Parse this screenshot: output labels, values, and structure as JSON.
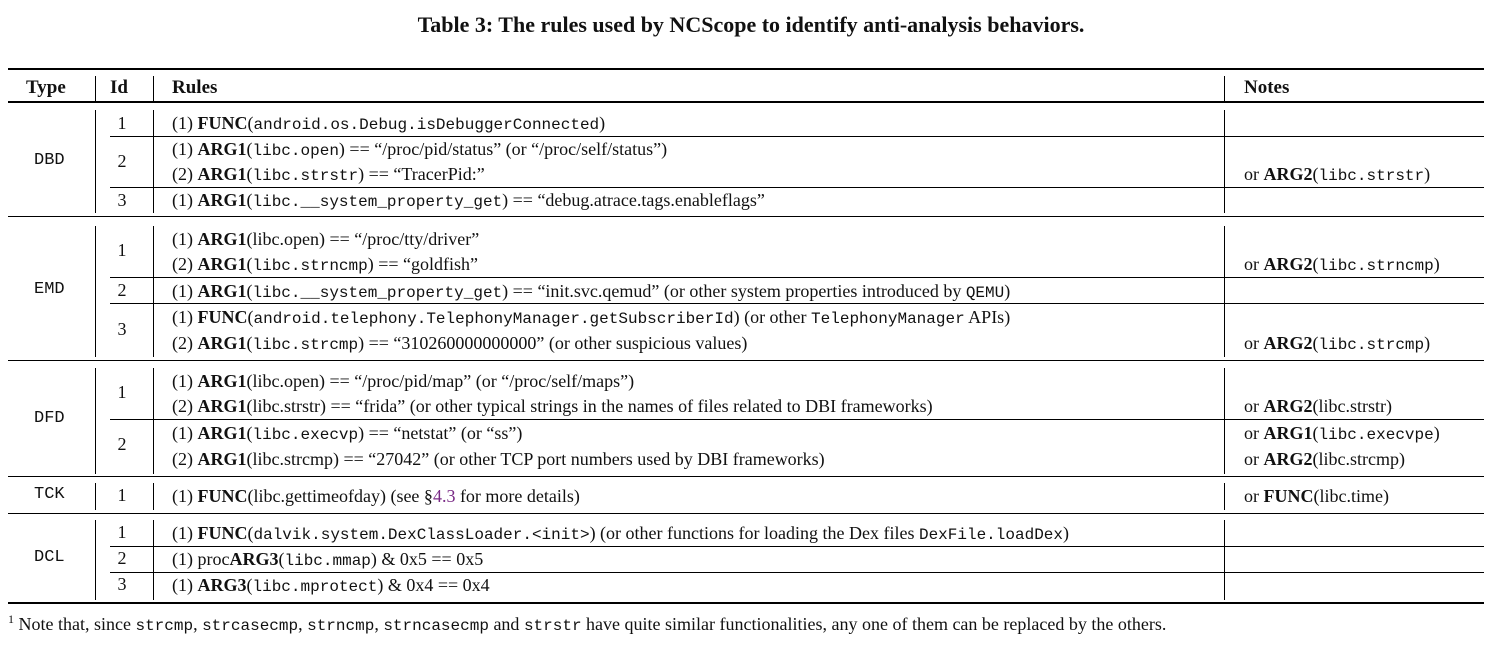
{
  "caption": "Table 3: The rules used by NCScope to identify anti-analysis behaviors.",
  "headers": {
    "type": "Type",
    "id": "Id",
    "rules": "Rules",
    "notes": "Notes"
  },
  "groups": [
    {
      "type": "DBD",
      "ids": [
        "1",
        "2",
        "3"
      ]
    },
    {
      "type": "EMD",
      "ids": [
        "1",
        "2",
        "3"
      ]
    },
    {
      "type": "DFD",
      "ids": [
        "1",
        "2"
      ]
    },
    {
      "type": "TCK",
      "ids": [
        "1"
      ]
    },
    {
      "type": "DCL",
      "ids": [
        "1",
        "2",
        "3"
      ]
    }
  ],
  "rows": [
    {
      "parts": [
        "(1) ",
        "FUNC",
        "(",
        "android.os.Debug.isDebuggerConnected",
        ")"
      ]
    },
    {
      "parts": [
        "(1) ",
        "ARG1",
        "(",
        "libc.open",
        ") == “/proc/pid/status” (or “/proc/self/status”)"
      ]
    },
    {
      "parts": [
        "(2) ",
        "ARG1",
        "(",
        "libc.strstr",
        ") == “TracerPid:”"
      ]
    },
    {
      "parts": [
        "(1) ",
        "ARG1",
        "(",
        "libc.__system_property_get",
        ") == “debug.atrace.tags.enableflags”"
      ]
    },
    {
      "parts": [
        "(1) ",
        "ARG1",
        "(libc.open) == “/proc/tty/driver”"
      ]
    },
    {
      "parts": [
        "(2) ",
        "ARG1",
        "(",
        "libc.strncmp",
        ") == “goldfish”"
      ]
    },
    {
      "parts": [
        "(1) ",
        "ARG1",
        "(",
        "libc.__system_property_get",
        ") == “init.svc.qemud” (or other system properties introduced by ",
        "QEMU",
        ")"
      ]
    },
    {
      "parts": [
        "(1) ",
        "FUNC",
        "(",
        "android.telephony.TelephonyManager.getSubscriberId",
        ") (or other ",
        "TelephonyManager",
        " APIs)"
      ]
    },
    {
      "parts": [
        "(2) ",
        "ARG1",
        "(",
        "libc.strcmp",
        ") == “310260000000000” (or other suspicious values)"
      ]
    },
    {
      "parts": [
        "(1) ",
        "ARG1",
        "(libc.open) == “/proc/pid/map” (or “/proc/self/maps”)"
      ]
    },
    {
      "parts": [
        "(2) ",
        "ARG1",
        "(libc.strstr) == “frida” (or other typical strings in the names of files related to DBI frameworks)"
      ]
    },
    {
      "parts": [
        "(1) ",
        "ARG1",
        "(",
        "libc.execvp",
        ") == “netstat” (or “ss”)"
      ]
    },
    {
      "parts": [
        "(2) ",
        "ARG1",
        "(libc.strcmp) == “27042” (or other TCP port numbers used by DBI frameworks)"
      ]
    },
    {
      "parts": [
        "(1) ",
        "FUNC",
        "(libc.gettimeofday) (see §",
        "4.3",
        " for more details)"
      ]
    },
    {
      "parts": [
        "(1) ",
        "FUNC",
        "(",
        "dalvik.system.DexClassLoader.<init>",
        ") (or other functions for loading the Dex files ",
        "DexFile.loadDex",
        ")"
      ]
    },
    {
      "parts": [
        "(1) proc",
        "ARG3",
        "(",
        "libc.mmap",
        ") & 0x5 == 0x5"
      ]
    },
    {
      "parts": [
        "(1) ",
        "ARG3",
        "(",
        "libc.mprotect",
        ") & 0x4 == 0x4"
      ]
    }
  ],
  "notes": [
    {
      "parts": [
        "or ",
        "ARG2",
        "(",
        "libc.strstr",
        ")"
      ]
    },
    {
      "parts": [
        "or ",
        "ARG2",
        "(",
        "libc.strncmp",
        ")"
      ]
    },
    {
      "parts": [
        "or ",
        "ARG2",
        "(",
        "libc.strcmp",
        ")"
      ]
    },
    {
      "parts": [
        "or ",
        "ARG2",
        "(libc.strstr)"
      ]
    },
    {
      "parts": [
        "or ",
        "ARG1",
        "(",
        "libc.execvpe",
        ")"
      ]
    },
    {
      "parts": [
        "or ",
        "ARG2",
        "(libc.strcmp)"
      ]
    },
    {
      "parts": [
        "or ",
        "FUNC",
        "(libc.time)"
      ]
    }
  ],
  "footnote": {
    "marker": "1",
    "parts": [
      " Note that, since ",
      "strcmp",
      ", ",
      "strcasecmp",
      ", ",
      "strncmp",
      ", ",
      "strncasecmp",
      " and ",
      "strstr",
      " have quite similar functionalities, any one of them can be replaced by the others."
    ]
  }
}
